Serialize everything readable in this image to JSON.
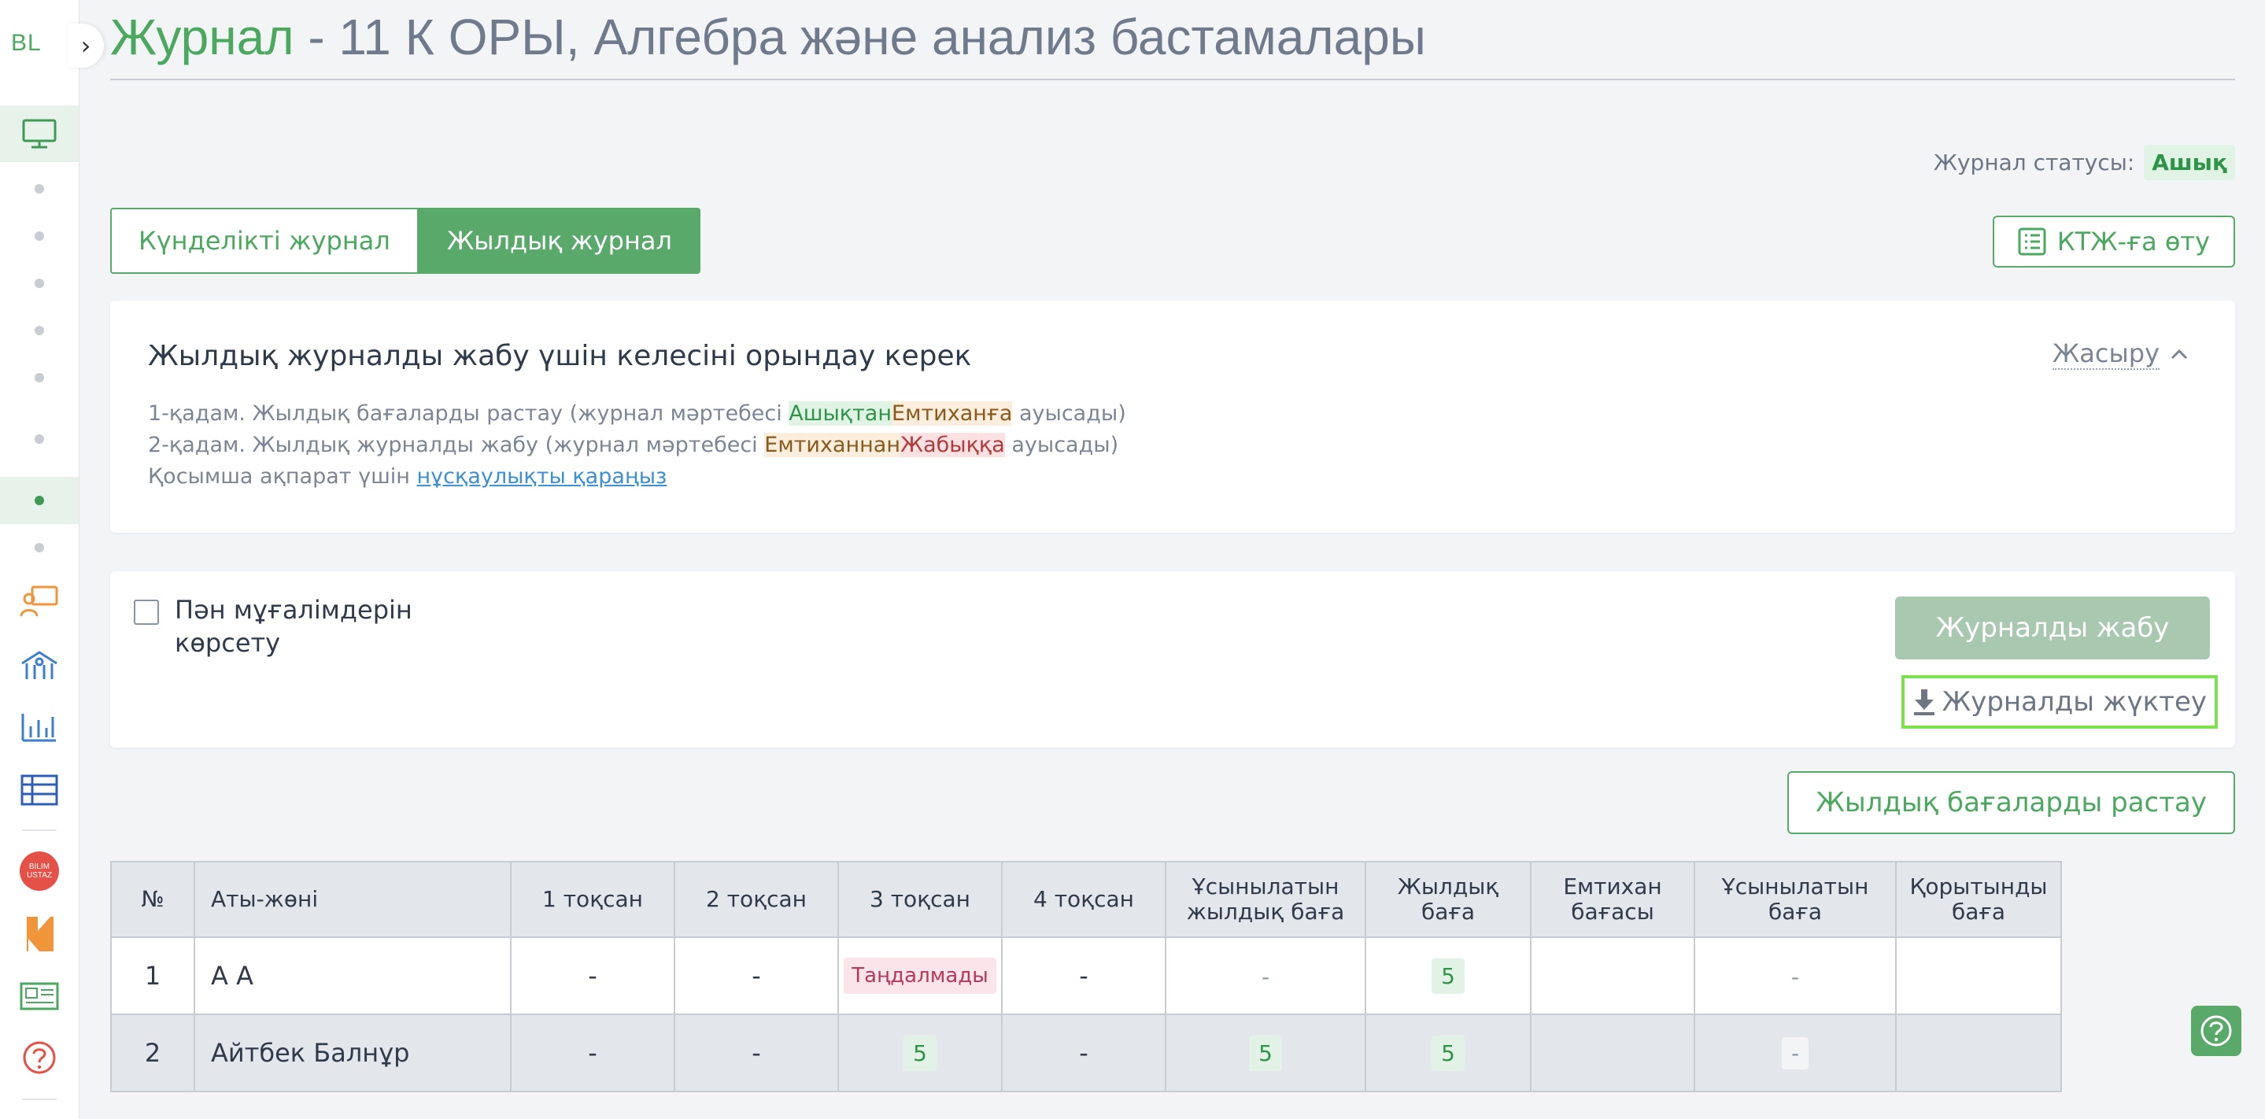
{
  "sidebar": {
    "logo": "BL"
  },
  "header": {
    "title_main": "Журнал",
    "title_rest": " - 11 К ОРЫ, Алгебра және анализ бастамалары",
    "status_label": "Журнал статусы:",
    "status_value": "Ашық"
  },
  "tabs": {
    "daily": "Күнделікті журнал",
    "yearly": "Жылдық журнал"
  },
  "ktj_button": "КТЖ-ға өту",
  "info": {
    "title": "Жылдық журналды жабу үшін келесіні орындау керек",
    "hide": "Жасыру",
    "step1_pre": "1-қадам. Жылдық бағаларды растау (журнал мәртебесі ",
    "step1_a": "Ашықтан",
    "step1_b": "Емтиханға",
    "step1_post": " ауысады)",
    "step2_pre": "2-қадам. Жылдық журналды жабу (журнал мәртебесі ",
    "step2_a": "Емтиханнан",
    "step2_b": "Жабыққа",
    "step2_post": " ауысады)",
    "extra_pre": "Қосымша ақпарат үшін ",
    "extra_link": "нұсқаулықты қараңыз"
  },
  "actions": {
    "show_teachers_line1": "Пән мұғалімдерін",
    "show_teachers_line2": "көрсету",
    "close_journal": "Журналды жабу",
    "download_journal": "Журналды жүктеу",
    "confirm_grades": "Жылдық бағаларды растау"
  },
  "table": {
    "headers": {
      "num": "№",
      "name": "Аты-жөні",
      "q1": "1 тоқсан",
      "q2": "2 тоқсан",
      "q3": "3 тоқсан",
      "q4": "4 тоқсан",
      "rec_year_1": "Ұсынылатын",
      "rec_year_2": "жылдық баға",
      "year": "Жылдық баға",
      "exam_1": "Емтихан",
      "exam_2": "бағасы",
      "rec": "Ұсынылатын баға",
      "final_1": "Қорытынды",
      "final_2": "баға"
    },
    "rows": [
      {
        "num": "1",
        "name": "А А",
        "q1": "-",
        "q2": "-",
        "q3": "Таңдалмады",
        "q4": "-",
        "rec_year": "-",
        "year": "5",
        "exam": "",
        "rec": "-",
        "final": ""
      },
      {
        "num": "2",
        "name": "Айтбек Балнұр",
        "q1": "-",
        "q2": "-",
        "q3": "5",
        "q4": "-",
        "rec_year": "5",
        "year": "5",
        "exam": "",
        "rec": "-",
        "final": ""
      }
    ]
  },
  "colors": {
    "accent": "#58a96a",
    "status_green": "#2e9448",
    "download_highlight": "#7ce04f"
  }
}
